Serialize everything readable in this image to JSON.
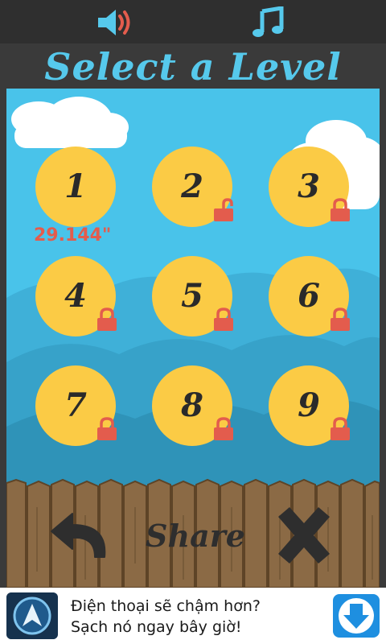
{
  "topbar": {
    "sound_icon": "speaker-icon",
    "music_icon": "music-note-icon"
  },
  "title": "Select a Level",
  "levels": [
    {
      "number": "1",
      "locked": false
    },
    {
      "number": "2",
      "locked": true
    },
    {
      "number": "3",
      "locked": true
    },
    {
      "number": "4",
      "locked": true
    },
    {
      "number": "5",
      "locked": true
    },
    {
      "number": "6",
      "locked": true
    },
    {
      "number": "7",
      "locked": true
    },
    {
      "number": "8",
      "locked": true
    },
    {
      "number": "9",
      "locked": true
    }
  ],
  "best_time": "29.144\"",
  "bottom": {
    "back_icon": "back-arrow-icon",
    "share_label": "Share",
    "close_icon": "close-x-icon"
  },
  "ad": {
    "line1": "Điện thoại sẽ chậm hơn?",
    "line2": "Sạch nó ngay bây giờ!",
    "logo_icon": "app-logo-icon",
    "download_icon": "download-arrow-icon"
  },
  "colors": {
    "sky": "#49c3ea",
    "title": "#56c9ec",
    "level": "#fbcb45",
    "lock": "#e35c4d",
    "wood": "#8b6a45"
  }
}
